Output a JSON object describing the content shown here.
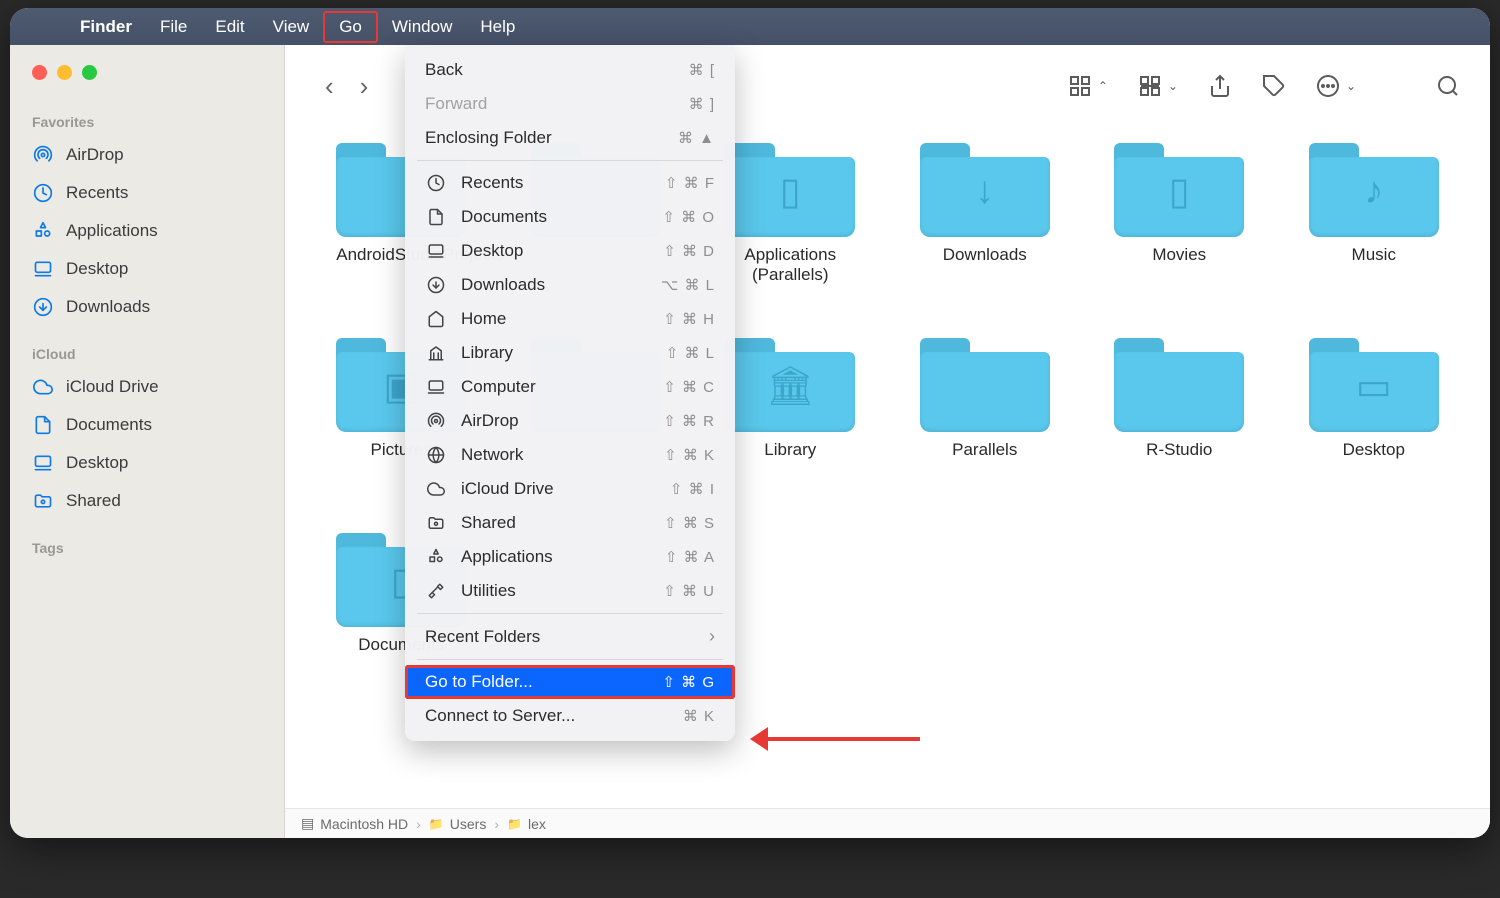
{
  "menubar": {
    "app_name": "Finder",
    "items": [
      "File",
      "Edit",
      "View",
      "Go",
      "Window",
      "Help"
    ],
    "highlighted": "Go"
  },
  "sidebar": {
    "favorites_title": "Favorites",
    "favorites": [
      {
        "label": "AirDrop",
        "icon": "airdrop"
      },
      {
        "label": "Recents",
        "icon": "clock"
      },
      {
        "label": "Applications",
        "icon": "apps"
      },
      {
        "label": "Desktop",
        "icon": "desktop"
      },
      {
        "label": "Downloads",
        "icon": "downloads"
      }
    ],
    "icloud_title": "iCloud",
    "icloud": [
      {
        "label": "iCloud Drive",
        "icon": "cloud"
      },
      {
        "label": "Documents",
        "icon": "doc"
      },
      {
        "label": "Desktop",
        "icon": "desktop"
      },
      {
        "label": "Shared",
        "icon": "shared"
      }
    ],
    "tags_title": "Tags"
  },
  "folders": [
    {
      "label": "AndroidStudioProjects",
      "glyph": ""
    },
    {
      "label": "",
      "glyph": ""
    },
    {
      "label": "Applications (Parallels)",
      "glyph": "▯"
    },
    {
      "label": "Downloads",
      "glyph": "↓"
    },
    {
      "label": "Movies",
      "glyph": "▯"
    },
    {
      "label": "Music",
      "glyph": "♪"
    },
    {
      "label": "Pictures",
      "glyph": "▣"
    },
    {
      "label": "",
      "glyph": ""
    },
    {
      "label": "Library",
      "glyph": "🏛"
    },
    {
      "label": "Parallels",
      "glyph": ""
    },
    {
      "label": "R-Studio",
      "glyph": ""
    },
    {
      "label": "Desktop",
      "glyph": "▭"
    },
    {
      "label": "Documents",
      "glyph": "▯"
    }
  ],
  "go_menu": {
    "items": [
      {
        "label": "Back",
        "shortcut": "⌘ [",
        "disabled": false,
        "icon": null
      },
      {
        "label": "Forward",
        "shortcut": "⌘ ]",
        "disabled": true,
        "icon": null
      },
      {
        "label": "Enclosing Folder",
        "shortcut": "⌘ ▲",
        "disabled": false,
        "icon": null
      }
    ],
    "places": [
      {
        "label": "Recents",
        "shortcut": "⇧ ⌘ F",
        "icon": "clock"
      },
      {
        "label": "Documents",
        "shortcut": "⇧ ⌘ O",
        "icon": "doc"
      },
      {
        "label": "Desktop",
        "shortcut": "⇧ ⌘ D",
        "icon": "desktop"
      },
      {
        "label": "Downloads",
        "shortcut": "⌥ ⌘ L",
        "icon": "downloads"
      },
      {
        "label": "Home",
        "shortcut": "⇧ ⌘ H",
        "icon": "home"
      },
      {
        "label": "Library",
        "shortcut": "⇧ ⌘ L",
        "icon": "library"
      },
      {
        "label": "Computer",
        "shortcut": "⇧ ⌘ C",
        "icon": "computer"
      },
      {
        "label": "AirDrop",
        "shortcut": "⇧ ⌘ R",
        "icon": "airdrop"
      },
      {
        "label": "Network",
        "shortcut": "⇧ ⌘ K",
        "icon": "network"
      },
      {
        "label": "iCloud Drive",
        "shortcut": "⇧ ⌘ I",
        "icon": "cloud"
      },
      {
        "label": "Shared",
        "shortcut": "⇧ ⌘ S",
        "icon": "shared"
      },
      {
        "label": "Applications",
        "shortcut": "⇧ ⌘ A",
        "icon": "apps"
      },
      {
        "label": "Utilities",
        "shortcut": "⇧ ⌘ U",
        "icon": "utilities"
      }
    ],
    "recent_folders": {
      "label": "Recent Folders"
    },
    "goto_folder": {
      "label": "Go to Folder...",
      "shortcut": "⇧ ⌘ G",
      "highlighted": true
    },
    "connect_server": {
      "label": "Connect to Server...",
      "shortcut": "⌘ K"
    }
  },
  "pathbar": {
    "segments": [
      "Macintosh HD",
      "Users",
      "lex"
    ]
  }
}
